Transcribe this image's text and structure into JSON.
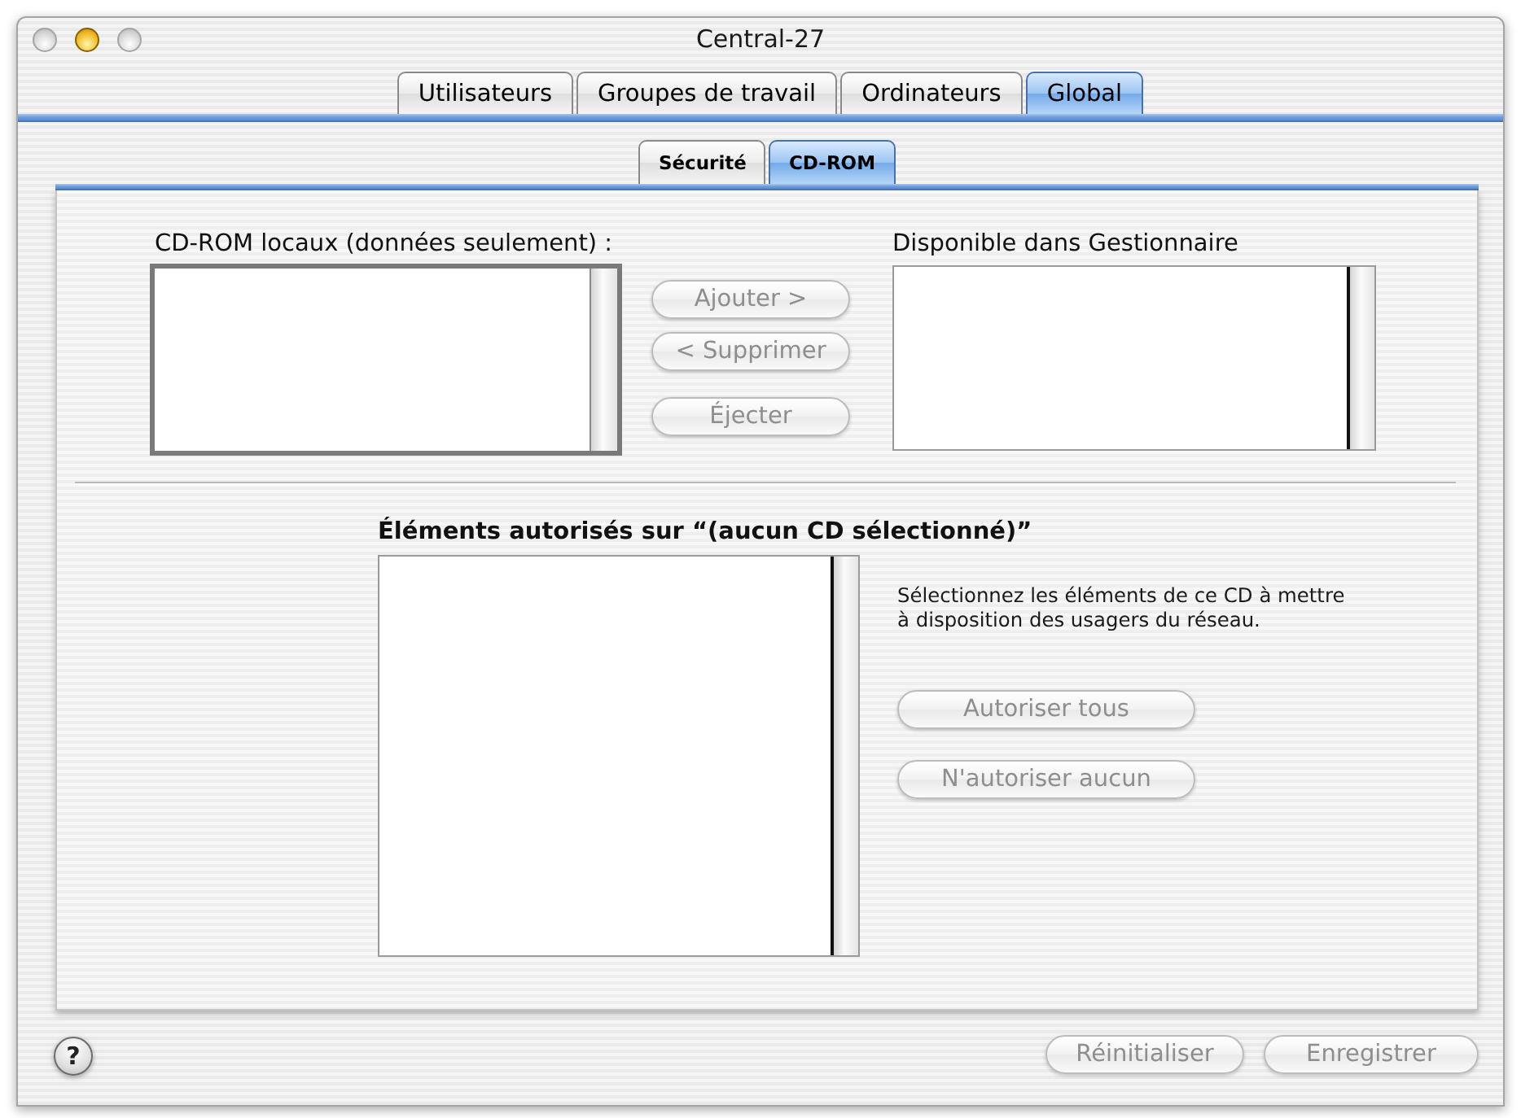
{
  "window": {
    "title": "Central-27",
    "controls": [
      {
        "kind": "close",
        "enabled": false
      },
      {
        "kind": "minimize",
        "enabled": true
      },
      {
        "kind": "zoom",
        "enabled": false
      }
    ]
  },
  "tabs": [
    {
      "label": "Utilisateurs",
      "selected": false
    },
    {
      "label": "Groupes de travail",
      "selected": false
    },
    {
      "label": "Ordinateurs",
      "selected": false
    },
    {
      "label": "Global",
      "selected": true
    }
  ],
  "subtabs": [
    {
      "label": "Sécurité",
      "selected": false
    },
    {
      "label": "CD-ROM",
      "selected": true
    }
  ],
  "local_cds": {
    "label": "CD-ROM locaux (données seulement) :",
    "focused": true
  },
  "transfer_buttons": [
    {
      "label": "Ajouter >",
      "disabled": true
    },
    {
      "label": "< Supprimer",
      "disabled": true
    },
    {
      "label": "Éjecter",
      "disabled": true
    }
  ],
  "available": {
    "label": "Disponible dans Gestionnaire",
    "focused": false
  },
  "allowed_items": {
    "label": "Éléments autorisés sur “(aucun CD sélectionné)”",
    "focused": false
  },
  "instructions": "Sélectionnez les éléments de ce CD à mettre à disposition des usagers du réseau.",
  "allow_buttons": [
    {
      "label": "Autoriser tous",
      "disabled": true
    },
    {
      "label": "N'autoriser aucun",
      "disabled": true
    }
  ],
  "footer": {
    "help": "?",
    "buttons": [
      {
        "label": "Réinitialiser",
        "disabled": true
      },
      {
        "label": "Enregistrer",
        "disabled": true
      }
    ]
  }
}
